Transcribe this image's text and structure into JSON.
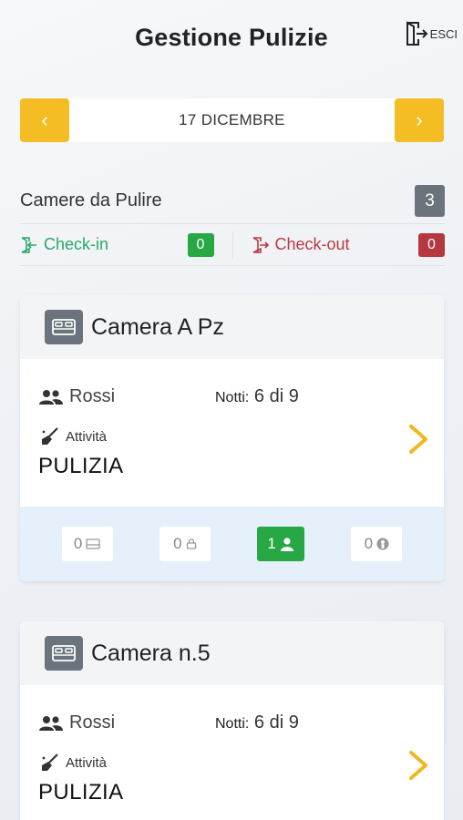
{
  "header": {
    "title": "Gestione Pulizie",
    "logout_label": "ESCI"
  },
  "date_nav": {
    "prev": "‹",
    "next": "›",
    "label": "17 DICEMBRE"
  },
  "summary": {
    "title": "Camere da Pulire",
    "total": "3",
    "checkin_label": "Check-in",
    "checkin_count": "0",
    "checkout_label": "Check-out",
    "checkout_count": "0"
  },
  "rooms": [
    {
      "name": "Camera A Pz",
      "guest": "Rossi",
      "nights_label": "Notti:",
      "nights_value": "6 di 9",
      "activity_label": "Attività",
      "activity_value": "PULIZIA",
      "chips": [
        "0",
        "0",
        "1",
        "0"
      ]
    },
    {
      "name": "Camera n.5",
      "guest": "Rossi",
      "nights_label": "Notti:",
      "nights_value": "6 di 9",
      "activity_label": "Attività",
      "activity_value": "PULIZIA"
    }
  ],
  "colors": {
    "accent_yellow": "#f5bd24",
    "green": "#28a745",
    "red": "#b5373f",
    "gray_badge": "#6b747c",
    "footer_blue": "#e6f0fa"
  }
}
